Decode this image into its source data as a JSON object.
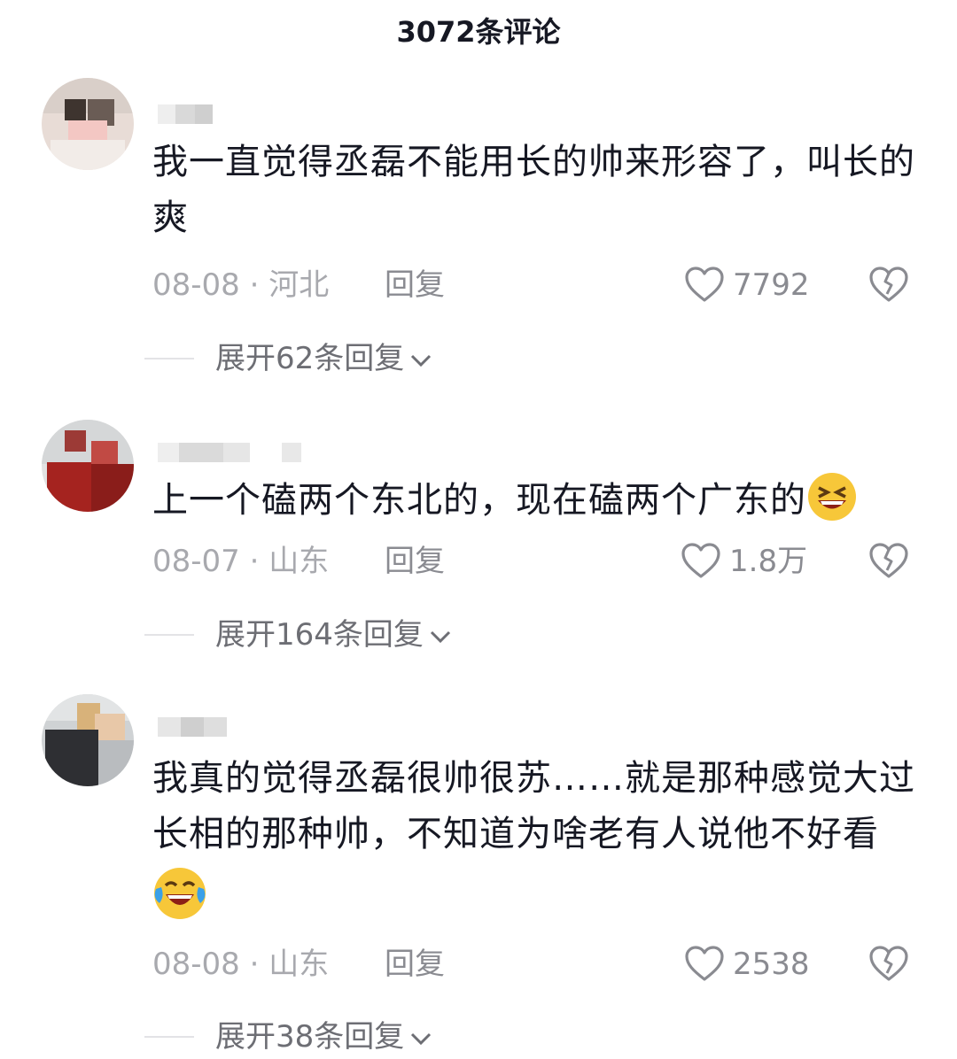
{
  "header": {
    "title": "3072条评论"
  },
  "comments": [
    {
      "text": "我一直觉得丞磊不能用长的帅来形容了，叫长的爽",
      "date_location": "08-08 · 河北",
      "reply_label": "回复",
      "likes": "7792",
      "expand_label": "展开62条回复"
    },
    {
      "text": "上一个磕两个东北的，现在磕两个广东的",
      "emoji": "grinning-squint-emoji",
      "date_location": "08-07 · 山东",
      "reply_label": "回复",
      "likes": "1.8万",
      "expand_label": "展开164条回复"
    },
    {
      "text": "我真的觉得丞磊很帅很苏……就是那种感觉大过长相的那种帅，不知道为啥老有人说他不好看",
      "emoji": "laughing-crying-emoji",
      "date_location": "08-08 · 山东",
      "reply_label": "回复",
      "likes": "2538",
      "expand_label": "展开38条回复"
    }
  ],
  "icons": {
    "like": "heart-outline-icon",
    "dislike": "broken-heart-icon",
    "expand": "chevron-down-icon"
  },
  "colors": {
    "text": "#161823",
    "meta": "#a8a9ae",
    "secondary": "#8a8b91",
    "emoji_yellow": "#f7c739"
  }
}
